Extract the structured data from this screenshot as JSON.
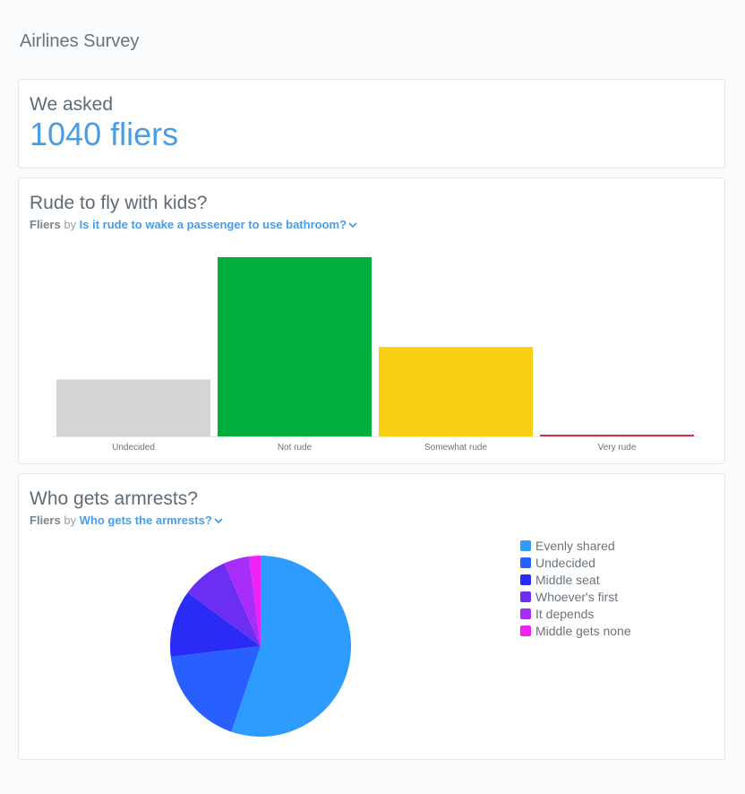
{
  "dashboard": {
    "title": "Airlines Survey"
  },
  "scalar_card": {
    "title": "We asked",
    "value": "1040 fliers"
  },
  "bar_card": {
    "title": "Rude to fly with kids?",
    "metric": "Fliers",
    "by": "by",
    "dimension": "Is it rude to wake a passenger to use bathroom?"
  },
  "pie_card": {
    "title": "Who gets armrests?",
    "metric": "Fliers",
    "by": "by",
    "dimension": "Who gets the armrests?"
  },
  "icons": {
    "dimension_dropdown": "chevron-down-icon"
  },
  "chart_data": [
    {
      "type": "bar",
      "categories": [
        "Undecided",
        "Not rude",
        "Somewhat rude",
        "Very rude"
      ],
      "values": [
        198,
        623,
        311,
        4
      ],
      "colors": [
        "#d4d4d4",
        "#00ae3b",
        "#f9cf13",
        "#d0314b"
      ],
      "title": "Rude to fly with kids?",
      "ylim": [
        0,
        623
      ],
      "grid": false
    },
    {
      "type": "pie",
      "categories": [
        "Evenly shared",
        "Undecided",
        "Middle seat",
        "Whoever's first",
        "It depends",
        "Middle gets none"
      ],
      "values": [
        596,
        193,
        129,
        90,
        49,
        22
      ],
      "colors": [
        "#2e9cff",
        "#2860ff",
        "#2a2cf6",
        "#6b2ef3",
        "#a82df9",
        "#ee22f5"
      ],
      "title": "Who gets armrests?",
      "legend": "right"
    }
  ]
}
